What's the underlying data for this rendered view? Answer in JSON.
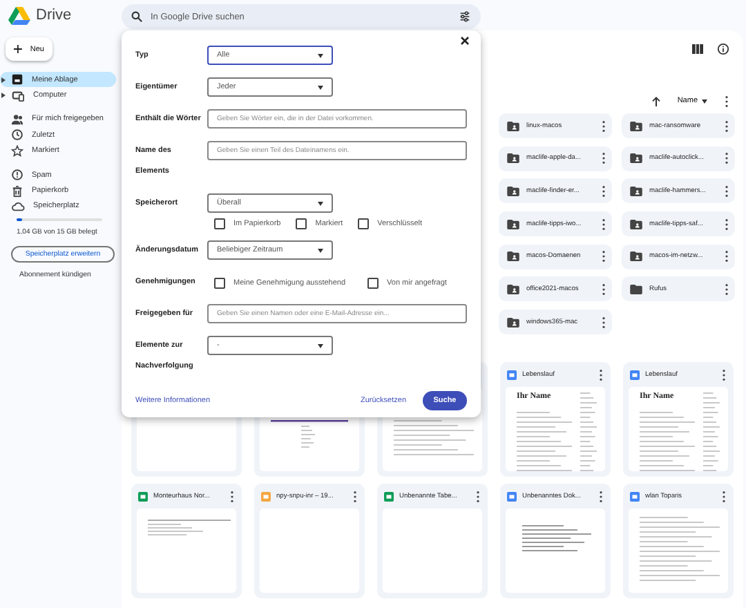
{
  "app": {
    "name": "Drive"
  },
  "search": {
    "placeholder": "In Google Drive suchen"
  },
  "new_button": {
    "label": "Neu"
  },
  "sidebar": {
    "items": [
      {
        "label": "Meine Ablage",
        "kind": "drive",
        "expandable": true,
        "selected": true
      },
      {
        "label": "Computer",
        "kind": "computer",
        "expandable": true,
        "selected": false
      },
      {
        "label": "Für mich freigegeben",
        "kind": "shared",
        "expandable": false,
        "selected": false
      },
      {
        "label": "Zuletzt",
        "kind": "recent",
        "expandable": false,
        "selected": false
      },
      {
        "label": "Markiert",
        "kind": "starred",
        "expandable": false,
        "selected": false
      },
      {
        "label": "Spam",
        "kind": "spam",
        "expandable": false,
        "selected": false
      },
      {
        "label": "Papierkorb",
        "kind": "trash",
        "expandable": false,
        "selected": false
      },
      {
        "label": "Speicherplatz",
        "kind": "storage",
        "expandable": false,
        "selected": false
      }
    ],
    "storage": {
      "level": 0.07,
      "text": "1,04 GB von 15 GB belegt"
    },
    "upgrade_button": "Speicherplatz erweitern",
    "cancel_link": "Abonnement kündigen"
  },
  "sort": {
    "label": "Name"
  },
  "folders": [
    {
      "name": "linux-macos",
      "kind": "shared"
    },
    {
      "name": "mac-ransomware",
      "kind": "shared"
    },
    {
      "name": "maclife-apple-da...",
      "kind": "shared"
    },
    {
      "name": "maclife-autoclick...",
      "kind": "shared"
    },
    {
      "name": "maclife-finder-er...",
      "kind": "shared"
    },
    {
      "name": "maclife-hammers...",
      "kind": "shared"
    },
    {
      "name": "maclife-tipps-iwo...",
      "kind": "shared"
    },
    {
      "name": "maclife-tipps-saf...",
      "kind": "shared"
    },
    {
      "name": "macos-Domaenen",
      "kind": "shared"
    },
    {
      "name": "macos-im-netzw...",
      "kind": "shared"
    },
    {
      "name": "office2021-macos",
      "kind": "shared"
    },
    {
      "name": "Rufus",
      "kind": "plain"
    },
    {
      "name": "windows365-mac",
      "kind": "shared"
    }
  ],
  "files": [
    {
      "kind": "covered"
    },
    {
      "kind": "covered"
    },
    {
      "kind": "covered"
    },
    {
      "name": "Lebenslauf",
      "kind": "doc",
      "heading": "Ihr Name"
    },
    {
      "name": "Lebenslauf",
      "kind": "doc",
      "heading": "Ihr Name"
    },
    {
      "name": "Monteurhaus Nor...",
      "kind": "sheet"
    },
    {
      "name": "npy-snpu-inr – 19...",
      "kind": "slides"
    },
    {
      "name": "Unbenannte Tabe...",
      "kind": "sheet"
    },
    {
      "name": "Unbenanntes Dok...",
      "kind": "doc"
    },
    {
      "name": "wlan Toparis",
      "kind": "doc"
    }
  ],
  "dialog": {
    "rows": [
      {
        "kind": "select",
        "label_lines": [
          "Typ"
        ],
        "value": "Alle",
        "focused": true
      },
      {
        "kind": "select",
        "label_lines": [
          "Eigentümer"
        ],
        "value": "Jeder",
        "focused": false
      },
      {
        "kind": "input",
        "label_lines": [
          "Enthält die Wörter"
        ],
        "placeholder": "Geben Sie Wörter ein, die in der Datei vorkommen."
      },
      {
        "kind": "input",
        "label_lines": [
          "Name des",
          "Elements"
        ],
        "placeholder": "Geben Sie einen Teil des Dateinamens ein."
      },
      {
        "kind": "select",
        "label_lines": [
          "Speicherort"
        ],
        "value": "Überall",
        "focused": false,
        "options": [
          {
            "label": "Im Papierkorb",
            "checked": false
          },
          {
            "label": "Markiert",
            "checked": false
          },
          {
            "label": "Verschlüsselt",
            "checked": false
          }
        ]
      },
      {
        "kind": "select",
        "label_lines": [
          "Änderungsdatum"
        ],
        "value": "Beliebiger Zeitraum",
        "focused": false
      },
      {
        "kind": "checks",
        "label_lines": [
          "Genehmigungen"
        ],
        "options": [
          {
            "label": "Meine Genehmigung ausstehend",
            "checked": false
          },
          {
            "label": "Von mir angefragt",
            "checked": false
          }
        ]
      },
      {
        "kind": "input",
        "label_lines": [
          "Freigegeben für"
        ],
        "placeholder": "Geben Sie einen Namen oder eine E-Mail-Adresse ein..."
      },
      {
        "kind": "select",
        "label_lines": [
          "Elemente zur",
          "Nachverfolgung"
        ],
        "value": "-",
        "focused": false
      }
    ],
    "link": "Weitere Informationen",
    "reset_button": "Zurücksetzen",
    "search_button": "Suche"
  }
}
